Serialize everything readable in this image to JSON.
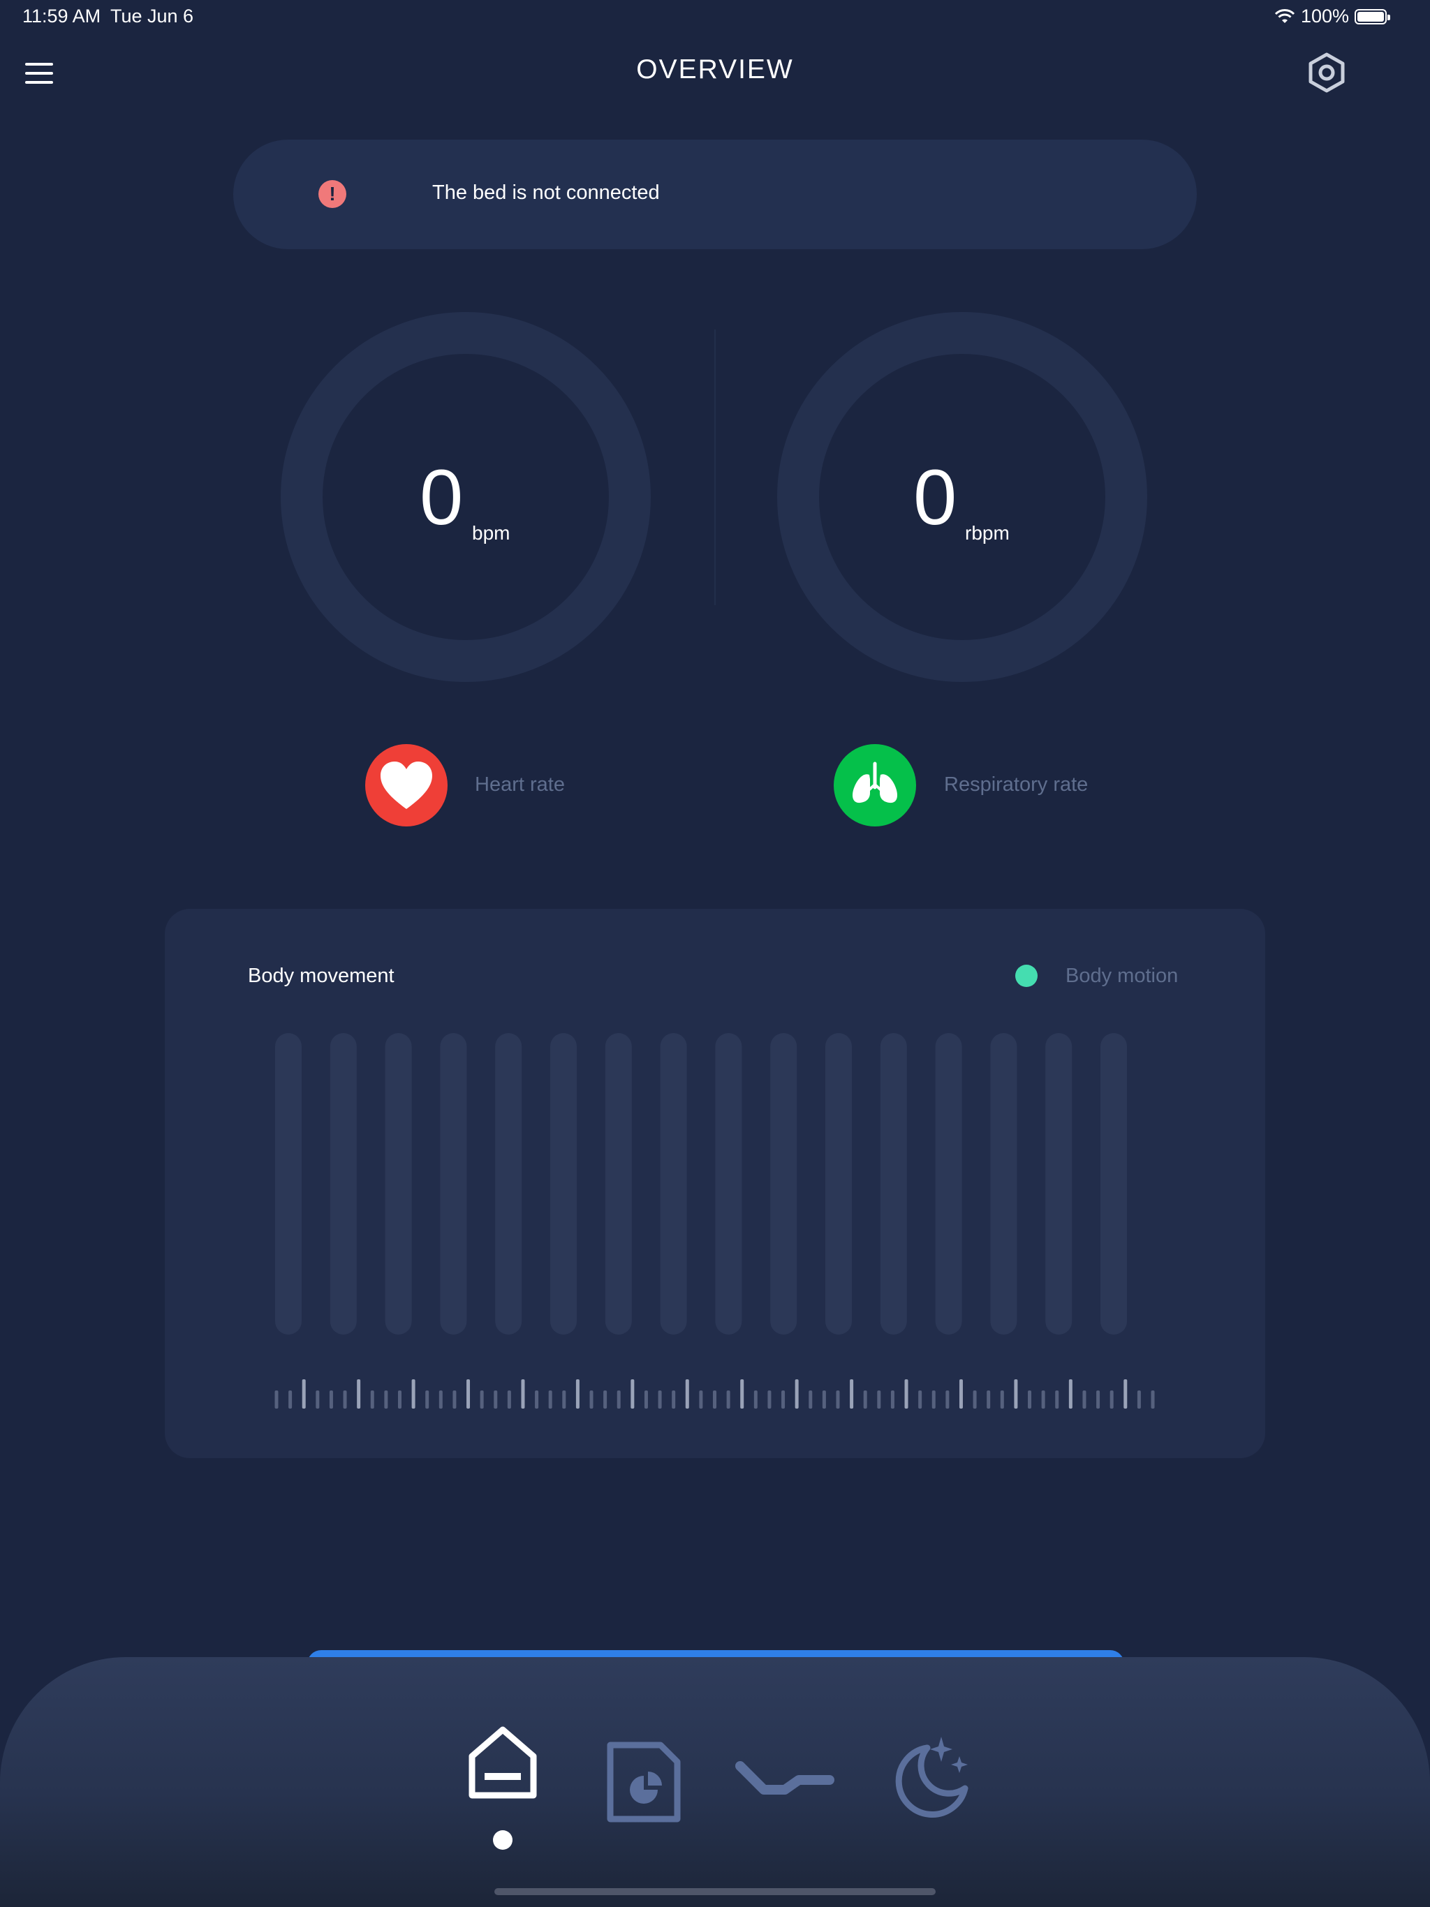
{
  "status_bar": {
    "time": "11:59 AM",
    "date": "Tue Jun 6",
    "battery": "100%"
  },
  "header": {
    "title": "OVERVIEW",
    "menu_icon": "hamburger-menu-icon",
    "settings_icon": "hexagon-settings-icon"
  },
  "banner": {
    "icon": "alert-icon",
    "icon_glyph": "!",
    "text": "The bed is not connected",
    "accent": "#f0797a"
  },
  "heart": {
    "value": "0",
    "unit": "bpm",
    "label": "Heart rate",
    "icon": "heart-icon",
    "color": "#ef3f37"
  },
  "respiration": {
    "value": "0",
    "unit": "rbpm",
    "label": "Respiratory rate",
    "icon": "lungs-icon",
    "color": "#05c04a"
  },
  "movement": {
    "title": "Body movement",
    "legend_label": "Body motion",
    "legend_color": "#45ddb0"
  },
  "chart_data": {
    "type": "bar",
    "title": "Body movement",
    "categories": [
      "",
      "",
      "",
      "",
      "",
      "",
      "",
      "",
      "",
      "",
      "",
      "",
      "",
      "",
      "",
      ""
    ],
    "series": [
      {
        "name": "Body motion",
        "values": [
          0,
          0,
          0,
          0,
          0,
          0,
          0,
          0,
          0,
          0,
          0,
          0,
          0,
          0,
          0,
          0
        ]
      }
    ],
    "legend": "top-right",
    "grid": false
  },
  "tabbar": {
    "tabs": [
      {
        "icon": "home-icon",
        "active": true
      },
      {
        "icon": "report-icon",
        "active": false
      },
      {
        "icon": "bed-position-icon",
        "active": false
      },
      {
        "icon": "moon-sleep-icon",
        "active": false
      }
    ],
    "accent": "#2f7fe8"
  }
}
